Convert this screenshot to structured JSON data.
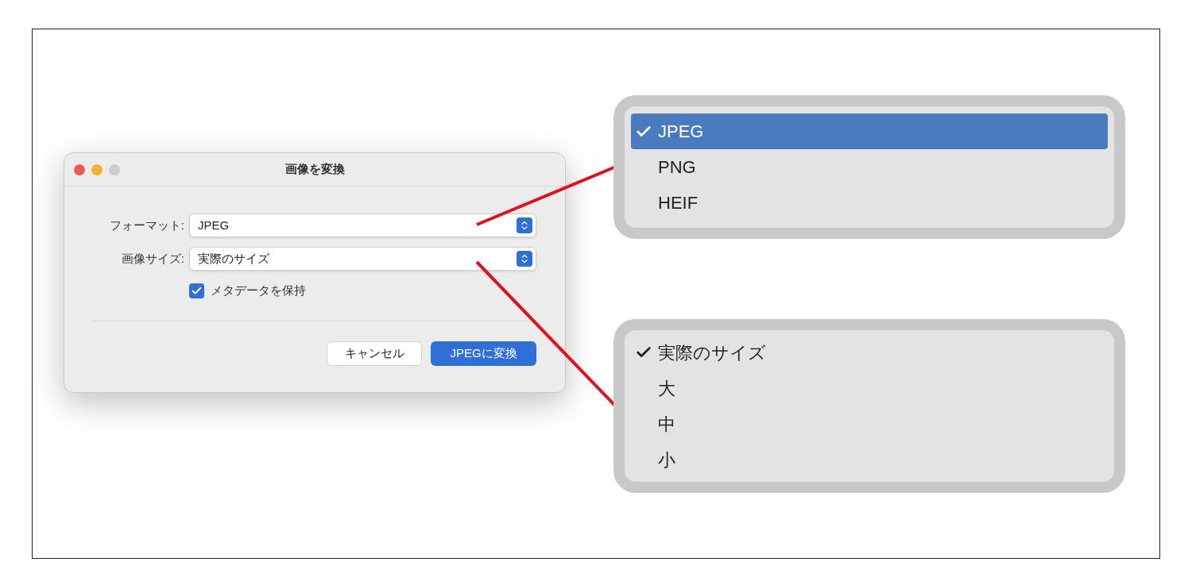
{
  "dialog": {
    "title": "画像を変換",
    "fields": [
      {
        "label": "フォーマット:",
        "value": "JPEG"
      },
      {
        "label": "画像サイズ:",
        "value": "実際のサイズ"
      }
    ],
    "checkbox": {
      "label": "メタデータを保持",
      "checked": true
    },
    "buttons": [
      {
        "label": "キャンセル",
        "primary": false
      },
      {
        "label": "JPEGに変換",
        "primary": true
      }
    ]
  },
  "menus": [
    {
      "items": [
        {
          "label": "JPEG",
          "checked": true,
          "selected": true
        },
        {
          "label": "PNG",
          "checked": false,
          "selected": false
        },
        {
          "label": "HEIF",
          "checked": false,
          "selected": false
        }
      ]
    },
    {
      "items": [
        {
          "label": "実際のサイズ",
          "checked": true,
          "selected": false
        },
        {
          "label": "大",
          "checked": false,
          "selected": false
        },
        {
          "label": "中",
          "checked": false,
          "selected": false
        },
        {
          "label": "小",
          "checked": false,
          "selected": false
        }
      ]
    }
  ]
}
